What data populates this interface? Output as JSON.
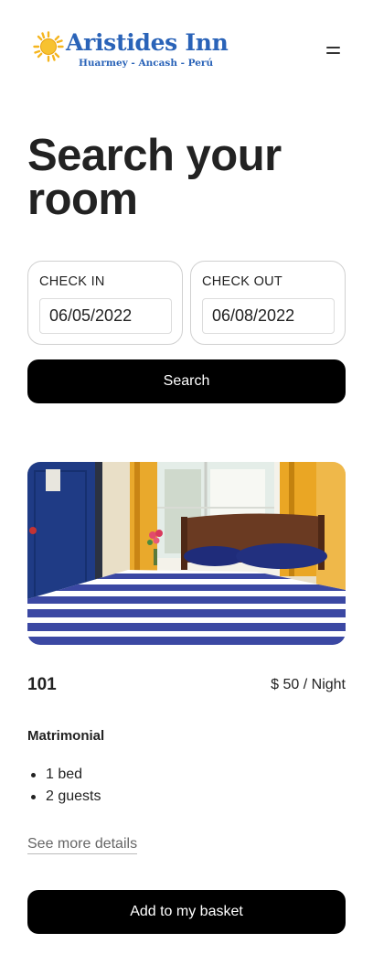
{
  "header": {
    "logo_name": "Aristides Inn",
    "logo_subtitle": "Huarmey - Ancash - Perú",
    "logo_icon": "sun-icon",
    "menu_icon": "hamburger-menu-icon",
    "brand_color": "#2a63b8"
  },
  "search": {
    "title": "Search your room",
    "check_in": {
      "label": "CHECK IN",
      "value": "06/05/2022"
    },
    "check_out": {
      "label": "CHECK OUT",
      "value": "06/08/2022"
    },
    "button_label": "Search"
  },
  "room": {
    "number": "101",
    "price": "$ 50 / Night",
    "type": "Matrimonial",
    "features": [
      "1 bed",
      "2 guests"
    ],
    "details_link": "See more details",
    "basket_button": "Add to my basket"
  }
}
